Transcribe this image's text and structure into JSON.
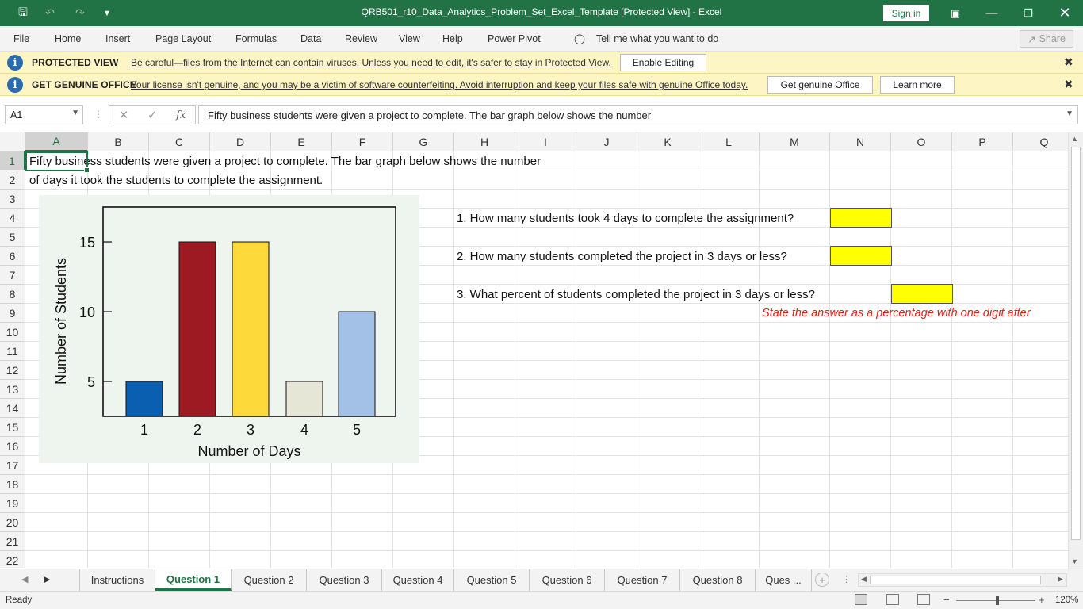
{
  "window": {
    "title": "QRB501_r10_Data_Analytics_Problem_Set_Excel_Template  [Protected View]  -  Excel",
    "sign_in": "Sign in"
  },
  "ribbon": {
    "tabs": [
      "File",
      "Home",
      "Insert",
      "Page Layout",
      "Formulas",
      "Data",
      "Review",
      "View",
      "Help",
      "Power Pivot"
    ],
    "tell_me": "Tell me what you want to do",
    "share": "Share"
  },
  "protected_view": {
    "heading": "PROTECTED VIEW",
    "message": "Be careful—files from the Internet can contain viruses. Unless you need to edit, it's safer to stay in Protected View.",
    "button": "Enable Editing"
  },
  "genuine_office": {
    "heading": "GET GENUINE OFFICE",
    "message": "Your license isn't genuine, and you may be a victim of software counterfeiting. Avoid interruption and keep your files safe with genuine Office today.",
    "button_primary": "Get genuine Office",
    "button_secondary": "Learn more"
  },
  "formula_bar": {
    "name_box": "A1",
    "content": "Fifty business students were given a project to complete. The bar graph below shows the number"
  },
  "grid": {
    "columns": [
      "A",
      "B",
      "C",
      "D",
      "E",
      "F",
      "G",
      "H",
      "I",
      "J",
      "K",
      "L",
      "M",
      "N",
      "O",
      "P",
      "Q"
    ],
    "rows": [
      "1",
      "2",
      "3",
      "4",
      "5",
      "6",
      "7",
      "8",
      "9",
      "10",
      "11",
      "12",
      "13",
      "14",
      "15",
      "16",
      "17",
      "18",
      "19",
      "20",
      "21",
      "22"
    ]
  },
  "cells": {
    "a1": "Fifty business students were given a project to complete. The bar graph below shows the number",
    "a2": "of days it took the students to  complete the assignment.",
    "h4": "1. How many students took 4 days to complete the assignment?",
    "h6": "2. How many students completed the project in 3 days or less?",
    "h8": "3. What percent of students completed the project in 3 days or less?",
    "n9": "State the answer as a percentage with one digit after"
  },
  "chart_data": {
    "type": "bar",
    "categories": [
      "1",
      "2",
      "3",
      "4",
      "5"
    ],
    "values": [
      5,
      15,
      15,
      5,
      10
    ],
    "bar_colors": [
      "#0b5fb0",
      "#9e1a22",
      "#fdd93a",
      "#e6e6d6",
      "#a3c0e6"
    ],
    "title": "",
    "xlabel": "Number of Days",
    "ylabel": "Number of Students",
    "ylim": [
      2.5,
      17.5
    ],
    "yticks": [
      5,
      10,
      15
    ],
    "background": "#eef5ee"
  },
  "sheets": {
    "tabs": [
      "Instructions",
      "Question 1",
      "Question 2",
      "Question 3",
      "Question 4",
      "Question 5",
      "Question 6",
      "Question 7",
      "Question 8",
      "Ques ..."
    ],
    "active": "Question 1"
  },
  "status": {
    "ready": "Ready",
    "zoom": "120%"
  },
  "colors": {
    "excel_green": "#217346",
    "answer_fill": "#ffff00",
    "note_red": "#e0201b"
  }
}
